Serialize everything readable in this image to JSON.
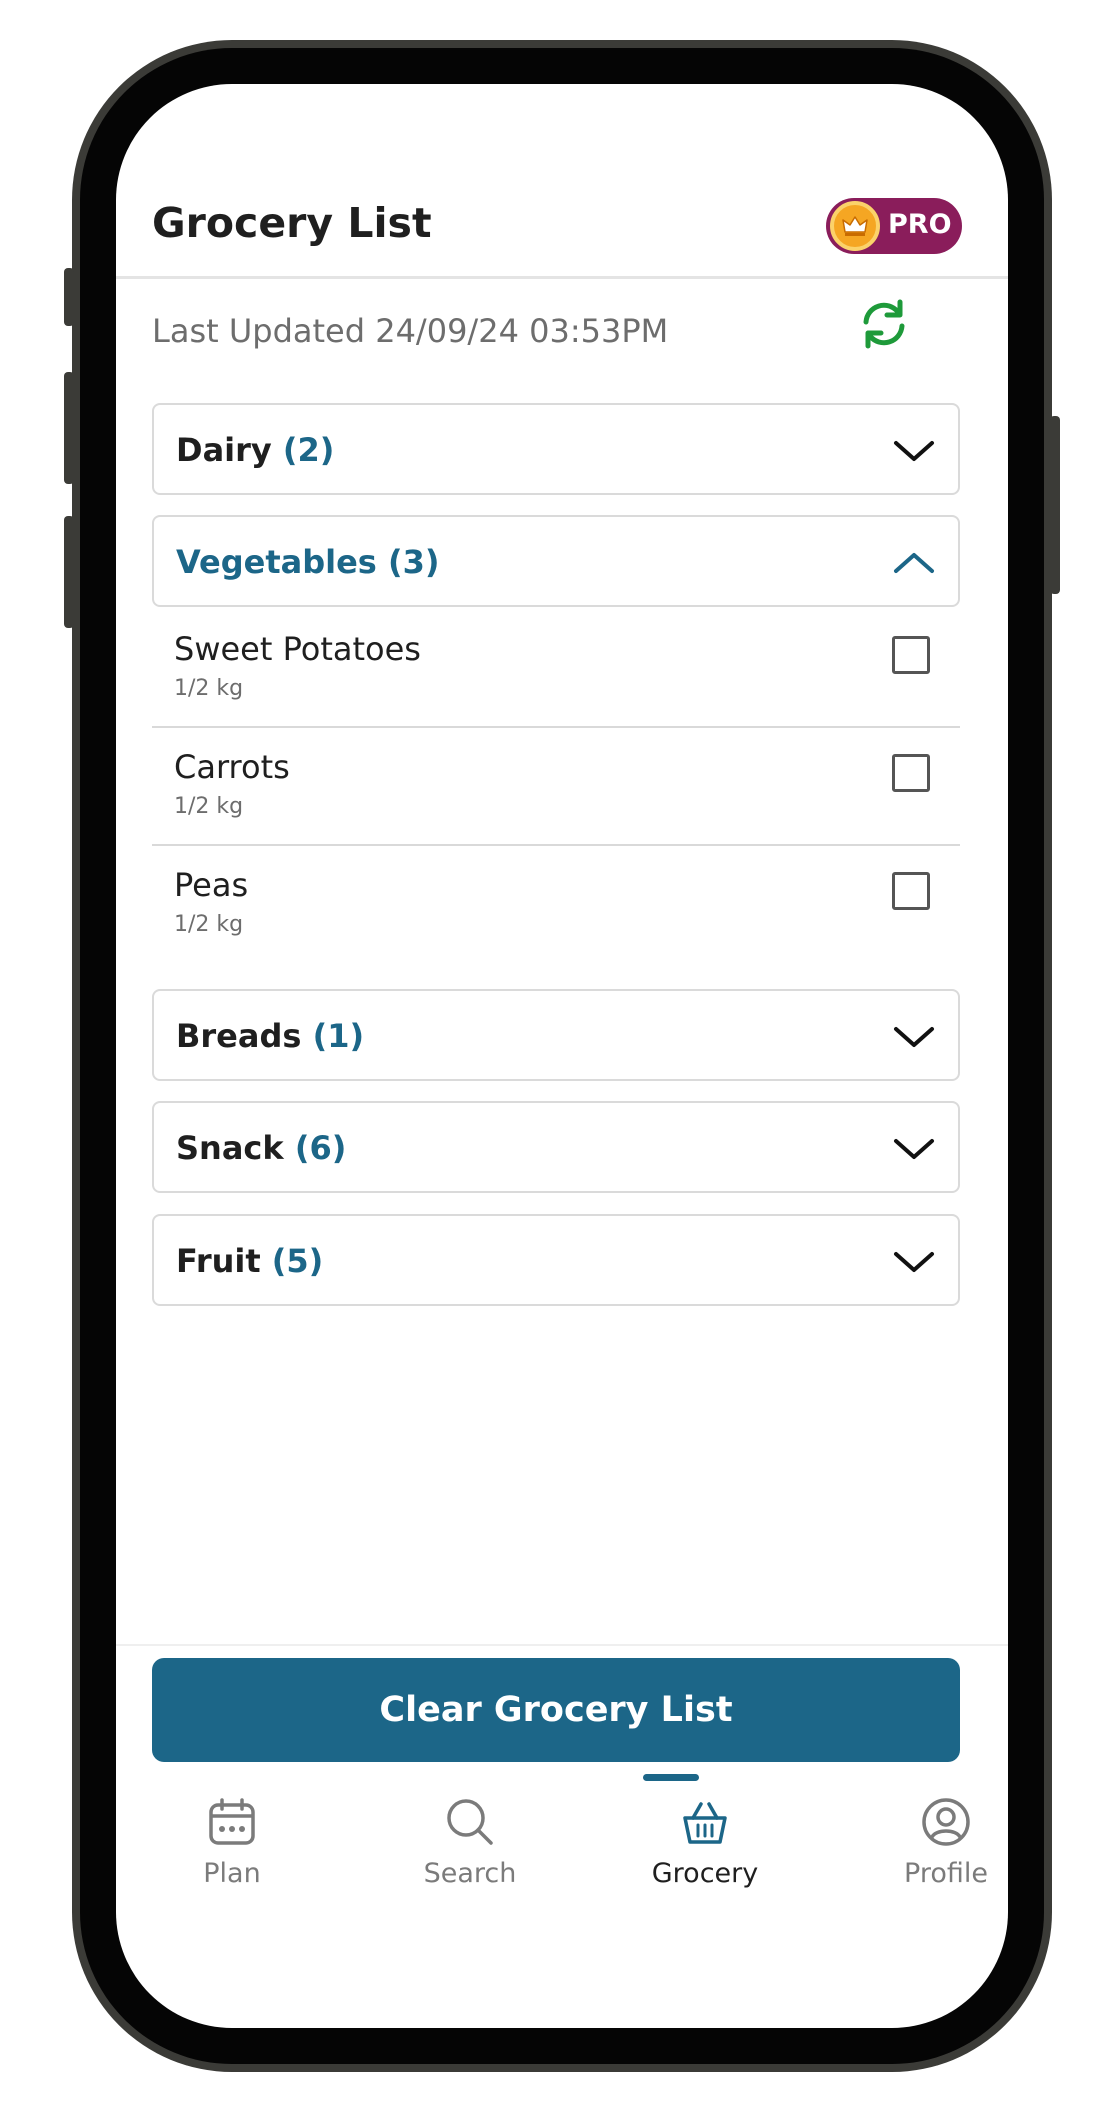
{
  "header": {
    "title": "Grocery List",
    "pro_badge": "PRO"
  },
  "status": {
    "last_updated": "Last Updated 24/09/24 03:53PM"
  },
  "categories": [
    {
      "name": "Dairy",
      "count": "(2)",
      "expanded": false
    },
    {
      "name": "Vegetables",
      "count": "(3)",
      "expanded": true,
      "items": [
        {
          "name": "Sweet Potatoes",
          "qty": "1/2 kg",
          "checked": false
        },
        {
          "name": "Carrots",
          "qty": "1/2 kg",
          "checked": false
        },
        {
          "name": "Peas",
          "qty": "1/2 kg",
          "checked": false
        }
      ]
    },
    {
      "name": "Breads",
      "count": "(1)",
      "expanded": false
    },
    {
      "name": "Snack",
      "count": "(6)",
      "expanded": false
    },
    {
      "name": "Fruit",
      "count": "(5)",
      "expanded": false
    }
  ],
  "actions": {
    "clear_label": "Clear Grocery List"
  },
  "nav": {
    "items": [
      {
        "label": "Plan",
        "icon": "calendar-icon"
      },
      {
        "label": "Search",
        "icon": "search-icon"
      },
      {
        "label": "Grocery",
        "icon": "basket-icon",
        "active": true
      },
      {
        "label": "Profile",
        "icon": "profile-icon"
      }
    ]
  },
  "colors": {
    "accent": "#1c6688",
    "pro_badge": "#8a1d5b",
    "refresh": "#1e9a3a"
  }
}
